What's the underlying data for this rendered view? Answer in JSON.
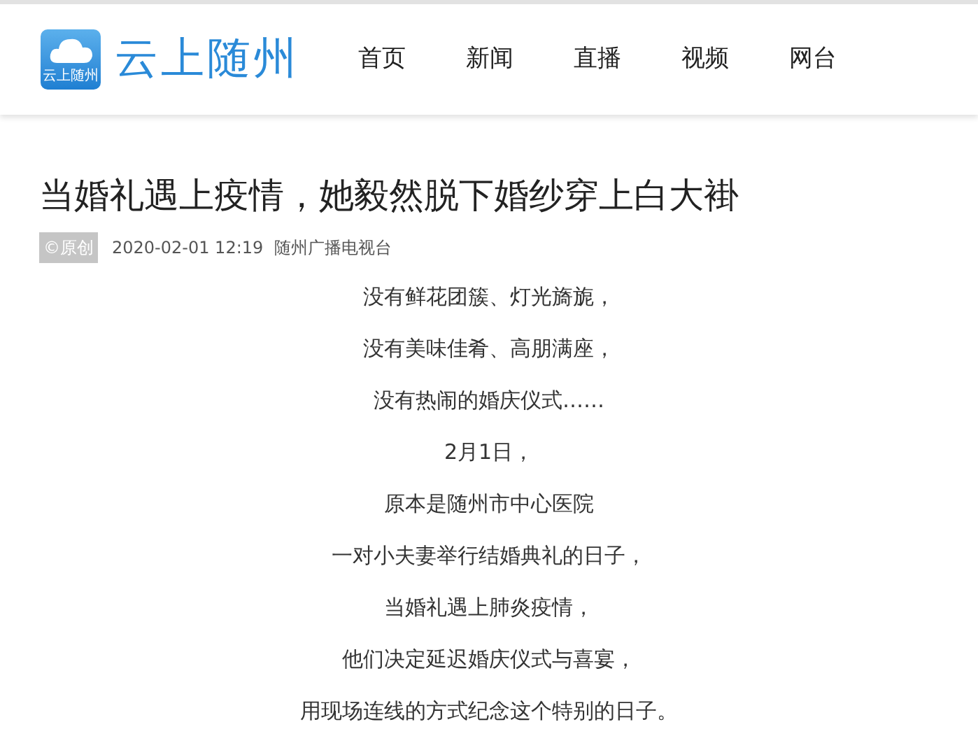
{
  "header": {
    "logo": {
      "badge_text": "云上随州",
      "name": "云上随州"
    },
    "nav": [
      {
        "label": "首页"
      },
      {
        "label": "新闻"
      },
      {
        "label": "直播"
      },
      {
        "label": "视频"
      },
      {
        "label": "网台"
      }
    ]
  },
  "article": {
    "title": "当婚礼遇上疫情，她毅然脱下婚纱穿上白大褂",
    "meta": {
      "tag": "©原创",
      "date": "2020-02-01 12:19",
      "source": "随州广播电视台"
    },
    "paragraphs": [
      "没有鲜花团簇、灯光旖旎，",
      "没有美味佳肴、高朋满座，",
      "没有热闹的婚庆仪式……",
      "2月1日，",
      "原本是随州市中心医院",
      "一对小夫妻举行结婚典礼的日子，",
      "当婚礼遇上肺炎疫情，",
      "他们决定延迟婚庆仪式与喜宴，",
      "用现场连线的方式纪念这个特别的日子。"
    ]
  }
}
